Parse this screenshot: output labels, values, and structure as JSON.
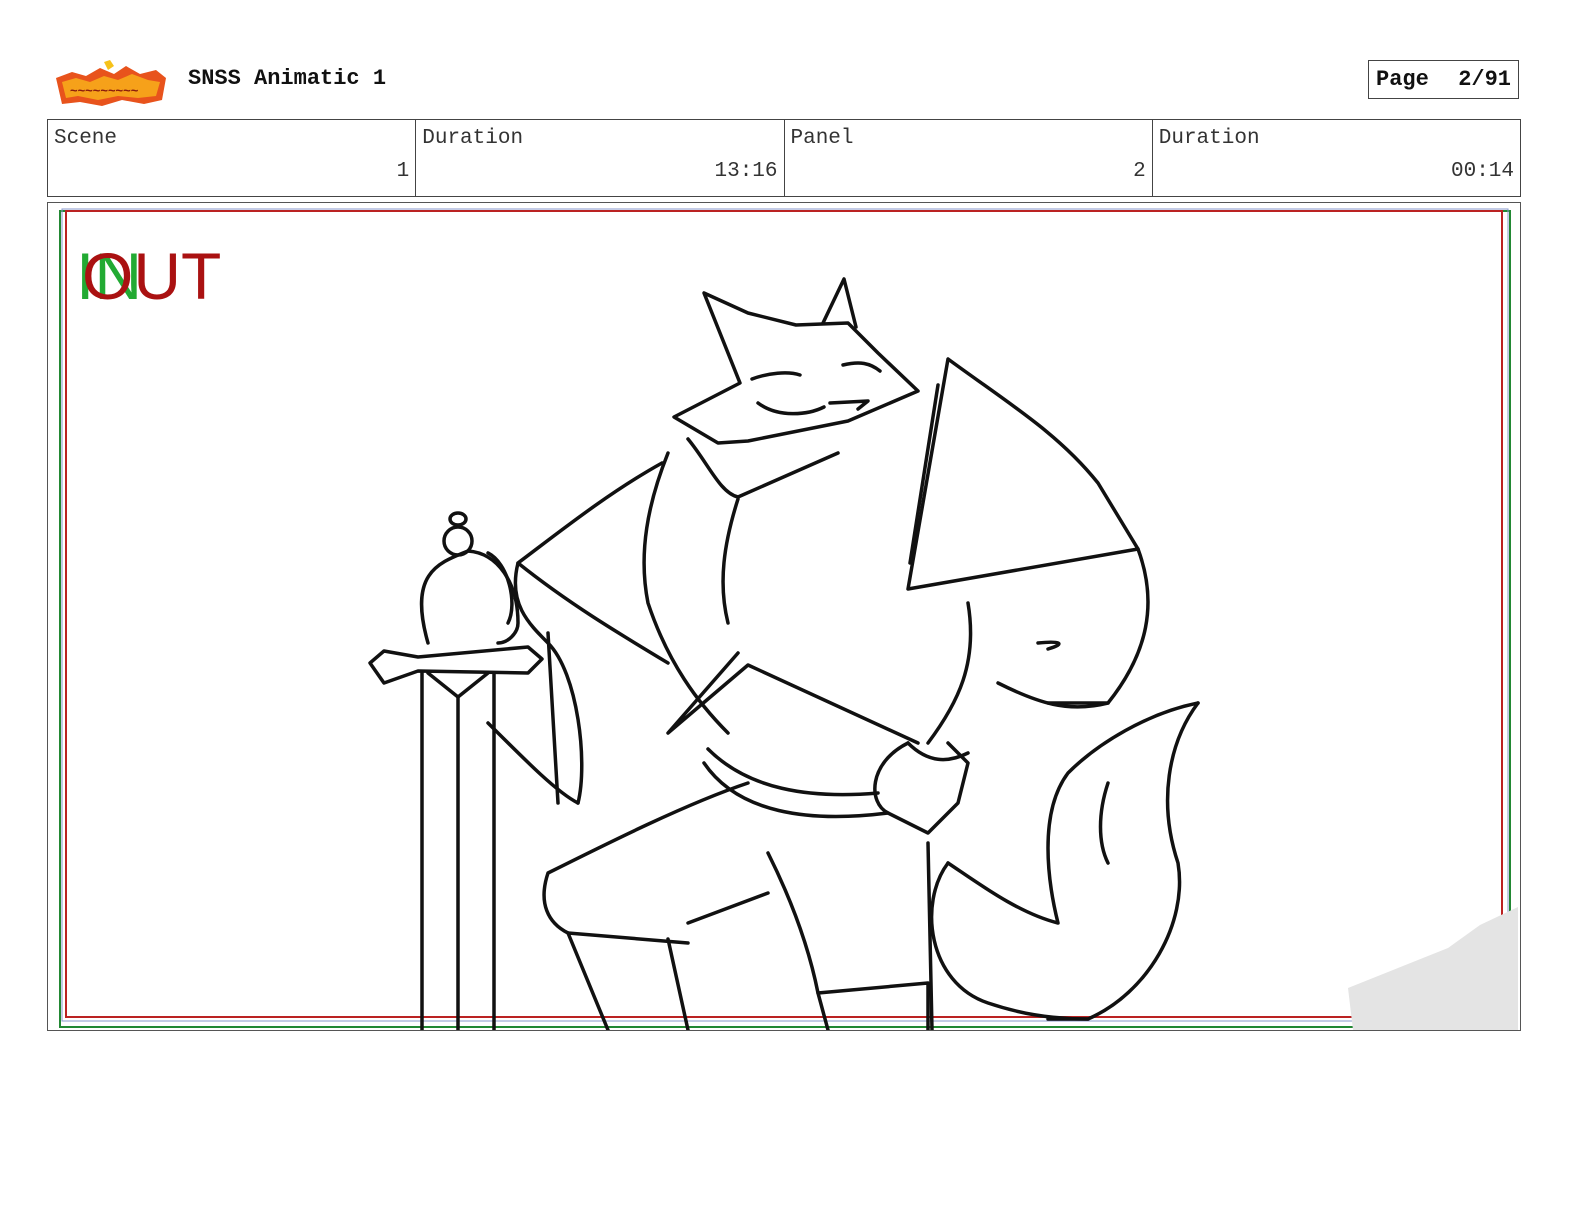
{
  "header": {
    "project_title": "SNSS Animatic 1",
    "page_label": "Page",
    "page_number": "2/91"
  },
  "info": {
    "scene_label": "Scene",
    "scene_value": "1",
    "duration_label": "Duration",
    "duration_value": "13:16",
    "panel_label": "Panel",
    "panel_value": "2",
    "panel_duration_label": "Duration",
    "panel_duration_value": "00:14"
  },
  "panel": {
    "in_marker": "IN",
    "out_marker": "OUT",
    "colors": {
      "in_green": "#22aa33",
      "out_red": "#aa1111",
      "frame_red": "#bb2222",
      "frame_green": "#228833",
      "sketch": "#111111"
    }
  },
  "icons": {
    "logo": "show-logo"
  }
}
